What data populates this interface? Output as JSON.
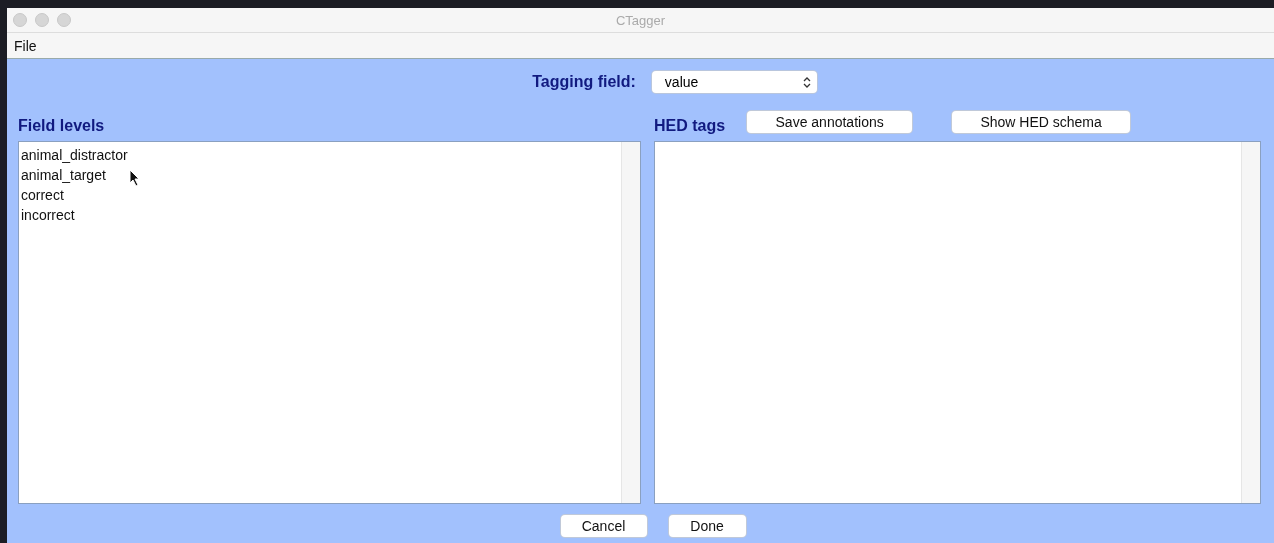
{
  "window": {
    "title": "CTagger"
  },
  "menu": [
    "File"
  ],
  "tagging_field": {
    "label": "Tagging field:",
    "value": "value"
  },
  "field_levels": {
    "title": "Field levels",
    "items": [
      "animal_distractor",
      "animal_target",
      "correct",
      "incorrect"
    ]
  },
  "hed_tags": {
    "title": "HED tags",
    "buttons": [
      "Save annotations",
      "Show HED schema"
    ]
  },
  "buttons": [
    "Cancel",
    "Done"
  ]
}
